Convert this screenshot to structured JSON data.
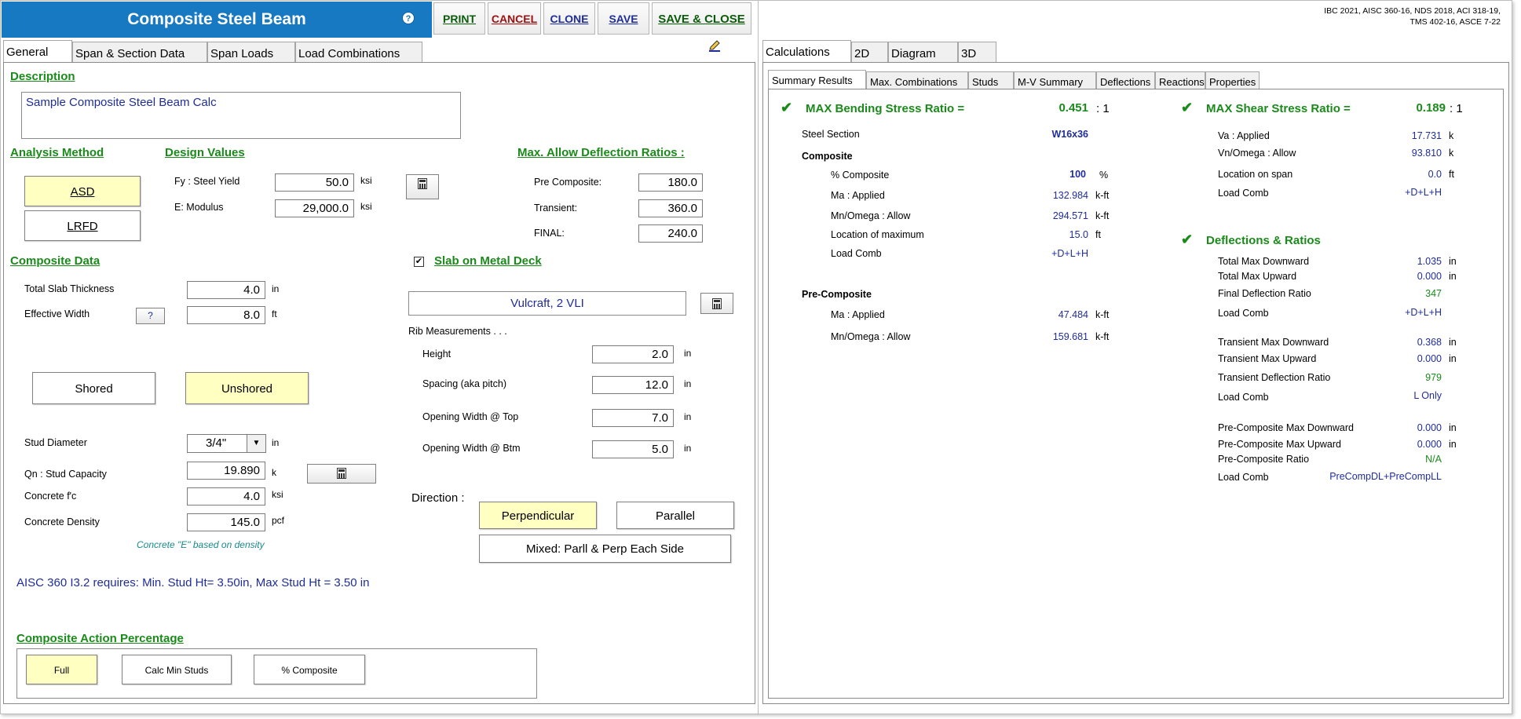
{
  "header": {
    "title": "Composite Steel Beam",
    "help_icon": "question-circle-icon",
    "buttons": {
      "print": "PRINT",
      "cancel": "CANCEL",
      "clone": "CLONE",
      "save": "SAVE",
      "save_close": "SAVE & CLOSE"
    },
    "codes_line1": "IBC 2021, AISC 360-16, NDS 2018, ACI 318-19,",
    "codes_line2": "TMS 402-16, ASCE 7-22"
  },
  "left_tabs": [
    "General",
    "Span & Section Data",
    "Span Loads",
    "Load Combinations"
  ],
  "edit_icon": "pencil-edit-icon",
  "general": {
    "description_header": "Description",
    "description_value": "Sample Composite Steel Beam Calc",
    "analysis_method_header": "Analysis Method",
    "asd_label": "ASD",
    "lrfd_label": "LRFD",
    "design_values_header": "Design Values",
    "fy_label": "Fy : Steel Yield",
    "fy_value": "50.0",
    "fy_unit": "ksi",
    "e_label": "E: Modulus",
    "e_value": "29,000.0",
    "e_unit": "ksi",
    "deflection_header": "Max. Allow Deflection Ratios :",
    "pre_composite_label": "Pre Composite:",
    "pre_composite_value": "180.0",
    "transient_label": "Transient:",
    "transient_value": "360.0",
    "final_label": "FINAL:",
    "final_value": "240.0",
    "composite_data_header": "Composite Data",
    "slab_thickness_label": "Total Slab Thickness",
    "slab_thickness_value": "4.0",
    "slab_thickness_unit": "in",
    "effective_width_label": "Effective Width",
    "effective_width_help": "?",
    "effective_width_value": "8.0",
    "effective_width_unit": "ft",
    "shored_label": "Shored",
    "unshored_label": "Unshored",
    "stud_diameter_label": "Stud Diameter",
    "stud_diameter_value": "3/4\"",
    "stud_diameter_unit": "in",
    "qn_label": "Qn : Stud Capacity",
    "qn_value": "19.890",
    "qn_unit": "k",
    "fc_label": "Concrete f'c",
    "fc_value": "4.0",
    "fc_unit": "ksi",
    "density_label": "Concrete Density",
    "density_value": "145.0",
    "density_unit": "pcf",
    "concrete_e_note": "Concrete \"E\" based on density",
    "aisc_note": "AISC 360 I3.2 requires: Min. Stud Ht=  3.50in, Max Stud Ht =  3.50 in",
    "slab_checkbox_mark": "✔",
    "slab_header": "Slab on Metal Deck",
    "deck_value": "Vulcraft, 2 VLI",
    "rib_header": "Rib Measurements . . .",
    "height_label": "Height",
    "height_value": "2.0",
    "height_unit": "in",
    "spacing_label": "Spacing  (aka pitch)",
    "spacing_value": "12.0",
    "spacing_unit": "in",
    "open_top_label": "Opening Width @ Top",
    "open_top_value": "7.0",
    "open_top_unit": "in",
    "open_btm_label": "Opening Width @ Btm",
    "open_btm_value": "5.0",
    "open_btm_unit": "in",
    "direction_label": "Direction :",
    "perpendicular_label": "Perpendicular",
    "parallel_label": "Parallel",
    "mixed_label": "Mixed: Parll & Perp Each Side",
    "composite_action_header": "Composite Action Percentage",
    "full_label": "Full",
    "calc_min_studs_label": "Calc Min Studs",
    "pct_composite_label": "% Composite"
  },
  "right_tabs": [
    "Calculations",
    "2D",
    "Diagram",
    "3D"
  ],
  "sub_tabs": [
    "Summary Results",
    "Max. Combinations",
    "Studs",
    "M-V Summary",
    "Deflections",
    "Reactions",
    "Properties"
  ],
  "results": {
    "bending_header": "MAX Bending Stress Ratio   =",
    "bending_value": "0.451",
    "bending_suffix": ": 1",
    "steel_section_label": "Steel Section",
    "steel_section_value": "W16x36",
    "composite_label": "Composite",
    "pct_composite_label": "% Composite",
    "pct_composite_value": "100",
    "pct_composite_unit": "%",
    "ma_label": "Ma : Applied",
    "ma_value": "132.984",
    "ma_unit": "k-ft",
    "mn_label": "Mn/Omega : Allow",
    "mn_value": "294.571",
    "mn_unit": "k-ft",
    "loc_max_label": "Location of maximum",
    "loc_max_value": "15.0",
    "loc_max_unit": "ft",
    "load_comb_label": "Load Comb",
    "load_comb_value": "+D+L+H",
    "pre_composite_label": "Pre-Composite",
    "pre_ma_label": "Ma : Applied",
    "pre_ma_value": "47.484",
    "pre_ma_unit": "k-ft",
    "pre_mn_label": "Mn/Omega : Allow",
    "pre_mn_value": "159.681",
    "pre_mn_unit": "k-ft",
    "shear_header": "MAX Shear Stress Ratio =",
    "shear_value": "0.189",
    "shear_suffix": ": 1",
    "va_label": "Va : Applied",
    "va_value": "17.731",
    "va_unit": "k",
    "vn_label": "Vn/Omega : Allow",
    "vn_value": "93.810",
    "vn_unit": "k",
    "loc_span_label": "Location on span",
    "loc_span_value": "0.0",
    "loc_span_unit": "ft",
    "shear_comb_label": "Load Comb",
    "shear_comb_value": "+D+L+H",
    "defl_header": "Deflections & Ratios",
    "tot_down_label": "Total Max Downward",
    "tot_down_value": "1.035",
    "tot_down_unit": "in",
    "tot_up_label": "Total Max Upward",
    "tot_up_value": "0.000",
    "tot_up_unit": "in",
    "final_ratio_label": "Final Deflection Ratio",
    "final_ratio_value": "347",
    "final_comb_label": "Load Comb",
    "final_comb_value": "+D+L+H",
    "tr_down_label": "Transient Max Downward",
    "tr_down_value": "0.368",
    "tr_down_unit": "in",
    "tr_up_label": "Transient Max Upward",
    "tr_up_value": "0.000",
    "tr_up_unit": "in",
    "tr_ratio_label": "Transient Deflection Ratio",
    "tr_ratio_value": "979",
    "tr_comb_label": "Load Comb",
    "tr_comb_value": "L Only",
    "pc_down_label": "Pre-Composite Max Downward",
    "pc_down_value": "0.000",
    "pc_down_unit": "in",
    "pc_up_label": "Pre-Composite Max Upward",
    "pc_up_value": "0.000",
    "pc_up_unit": "in",
    "pc_ratio_label": "Pre-Composite Ratio",
    "pc_ratio_value": "N/A",
    "pc_comb_label": "Load Comb",
    "pc_comb_value": "PreCompDL+PreCompLL",
    "check_icon": "✔"
  },
  "colors": {
    "title_bar": "#1679c2",
    "header_green": "#1a8a1a",
    "value_blue": "#1f2d9a",
    "selected_button": "#ffffc2"
  }
}
